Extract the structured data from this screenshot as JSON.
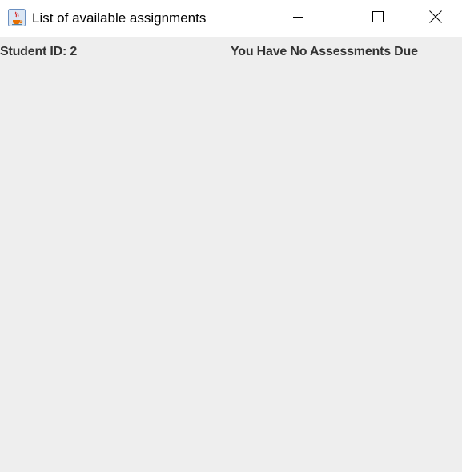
{
  "window": {
    "title": "List of available assignments",
    "icon": "java-cup-icon",
    "controls": [
      "minimize-icon",
      "maximize-icon",
      "close-icon"
    ]
  },
  "content": {
    "student_id_label": "Student ID: 2",
    "status_message": "You Have No Assessments Due"
  },
  "colors": {
    "titlebar_bg": "#ffffff",
    "content_bg": "#eeeeee",
    "text": "#333333"
  }
}
